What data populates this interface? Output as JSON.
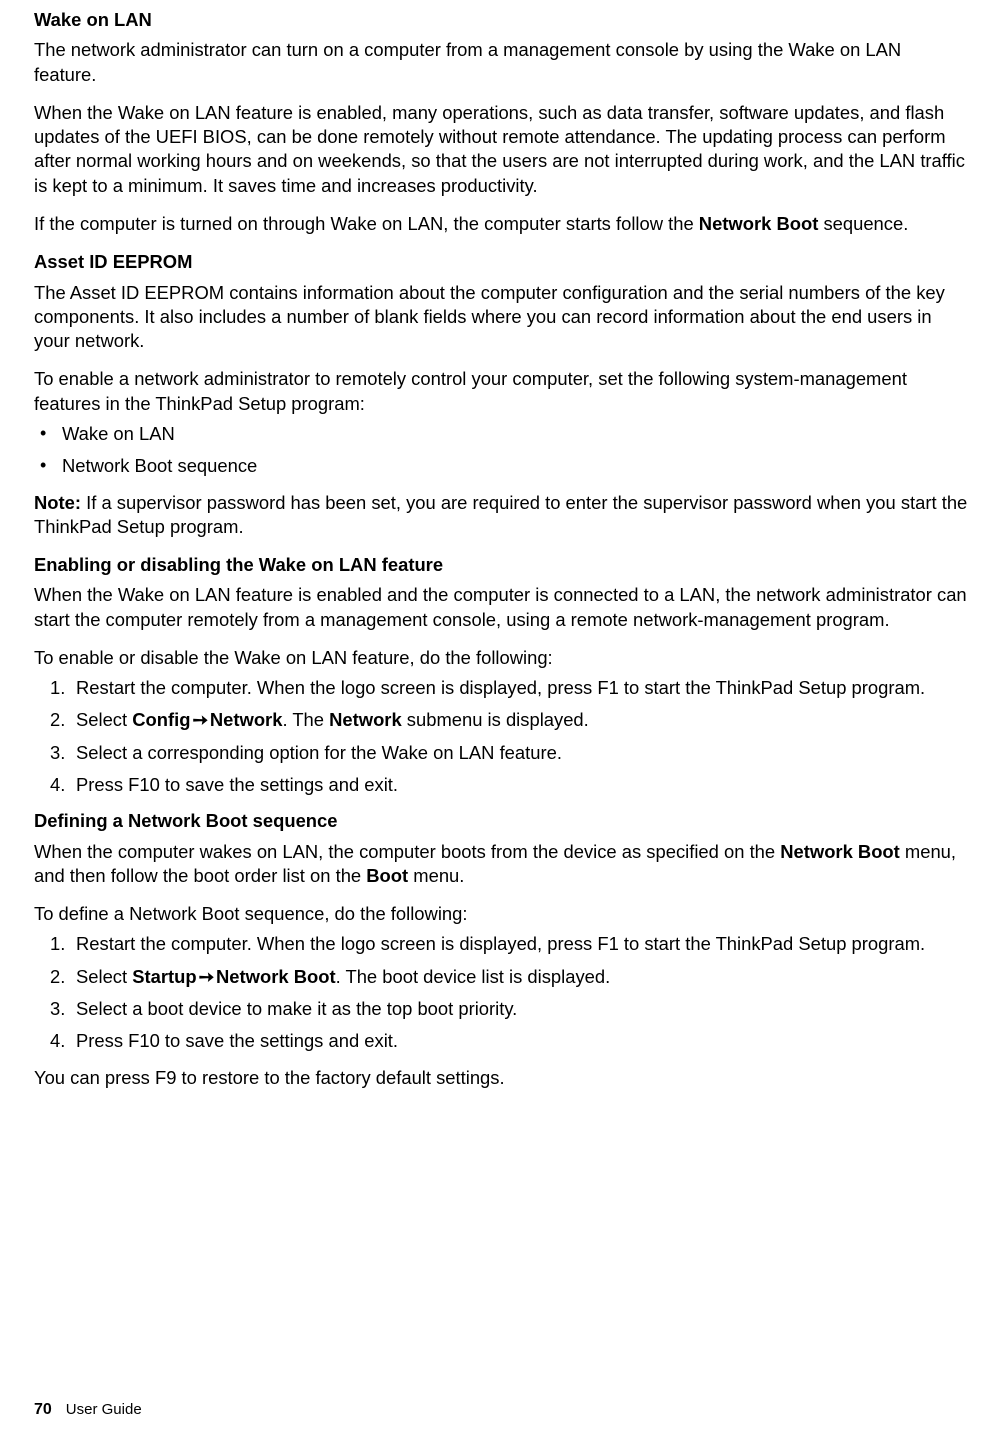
{
  "section1": {
    "heading": "Wake on LAN",
    "p1": "The network administrator can turn on a computer from a management console by using the Wake on LAN feature.",
    "p2": "When the Wake on LAN feature is enabled, many operations, such as data transfer, software updates, and flash updates of the UEFI BIOS, can be done remotely without remote attendance. The updating process can perform after normal working hours and on weekends, so that the users are not interrupted during work, and the LAN traffic is kept to a minimum. It saves time and increases productivity.",
    "p3a": "If the computer is turned on through Wake on LAN, the computer starts follow the ",
    "p3b": "Network Boot",
    "p3c": " sequence."
  },
  "section2": {
    "heading": "Asset ID EEPROM",
    "p1": "The Asset ID EEPROM contains information about the computer configuration and the serial numbers of the key components. It also includes a number of blank fields where you can record information about the end users in your network.",
    "p2": "To enable a network administrator to remotely control your computer, set the following system-management features in the ThinkPad Setup program:",
    "bullets": [
      "Wake on LAN",
      "Network Boot sequence"
    ],
    "noteLabel": "Note:  ",
    "noteBody": "If a supervisor password has been set, you are required to enter the supervisor password when you start the ThinkPad Setup program."
  },
  "section3": {
    "heading": "Enabling or disabling the Wake on LAN feature",
    "p1": "When the Wake on LAN feature is enabled and the computer is connected to a LAN, the network administrator can start the computer remotely from a management console, using a remote network-management program.",
    "p2": "To enable or disable the Wake on LAN feature, do the following:",
    "step1": "Restart the computer. When the logo screen is displayed, press F1 to start the ThinkPad Setup program.",
    "step2a": "Select ",
    "step2b": "Config",
    "step2arrow": " ➙ ",
    "step2c": "Network",
    "step2d": ". The ",
    "step2e": "Network",
    "step2f": " submenu is displayed.",
    "step3": "Select a corresponding option for the Wake on LAN feature.",
    "step4": "Press F10 to save the settings and exit."
  },
  "section4": {
    "heading": "Defining a Network Boot sequence",
    "p1a": "When the computer wakes on LAN, the computer boots from the device as specified on the ",
    "p1b": "Network Boot",
    "p1c": " menu, and then follow the boot order list on the ",
    "p1d": "Boot",
    "p1e": " menu.",
    "p2": "To define a Network Boot sequence, do the following:",
    "step1": "Restart the computer. When the logo screen is displayed, press F1 to start the ThinkPad Setup program.",
    "step2a": "Select ",
    "step2b": "Startup",
    "step2arrow": " ➙ ",
    "step2c": "Network Boot",
    "step2d": ". The boot device list is displayed.",
    "step3": "Select a boot device to make it as the top boot priority.",
    "step4": "Press F10 to save the settings and exit.",
    "p3": "You can press F9 to restore to the factory default settings."
  },
  "footer": {
    "page": "70",
    "doc": "User Guide"
  }
}
